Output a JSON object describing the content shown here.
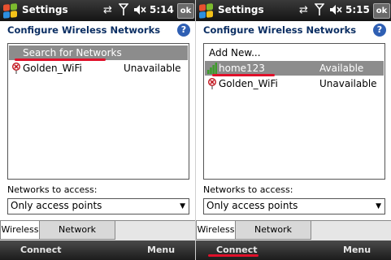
{
  "screens": [
    {
      "status": {
        "app_title": "Settings",
        "time": "5:14",
        "ok_label": "ok"
      },
      "header": {
        "title": "Configure Wireless Networks",
        "help_label": "?"
      },
      "networks": [
        {
          "name": "Search for Networks",
          "status": "",
          "icon": "",
          "selected": true
        },
        {
          "name": "Golden_WiFi",
          "status": "Unavailable",
          "icon": "unavailable-network-icon",
          "selected": false
        }
      ],
      "access": {
        "label": "Networks to access:",
        "value": "Only access points"
      },
      "tabs": [
        "Wireless",
        "Network Adapters"
      ],
      "softkeys": {
        "left": "Connect",
        "right": "Menu"
      }
    },
    {
      "status": {
        "app_title": "Settings",
        "time": "5:15",
        "ok_label": "ok"
      },
      "header": {
        "title": "Configure Wireless Networks",
        "help_label": "?"
      },
      "networks": [
        {
          "name": "Add New...",
          "status": "",
          "icon": "",
          "selected": false
        },
        {
          "name": "home123",
          "status": "Available",
          "icon": "signal-bars-icon",
          "selected": true
        },
        {
          "name": "Golden_WiFi",
          "status": "Unavailable",
          "icon": "unavailable-network-icon",
          "selected": false
        }
      ],
      "access": {
        "label": "Networks to access:",
        "value": "Only access points"
      },
      "tabs": [
        "Wireless",
        "Network Adapters"
      ],
      "softkeys": {
        "left": "Connect",
        "right": "Menu"
      }
    }
  ],
  "colors": {
    "highlight_red": "#e0102a",
    "selection_gray": "#8c8c8c",
    "title_blue": "#0c2f63"
  }
}
